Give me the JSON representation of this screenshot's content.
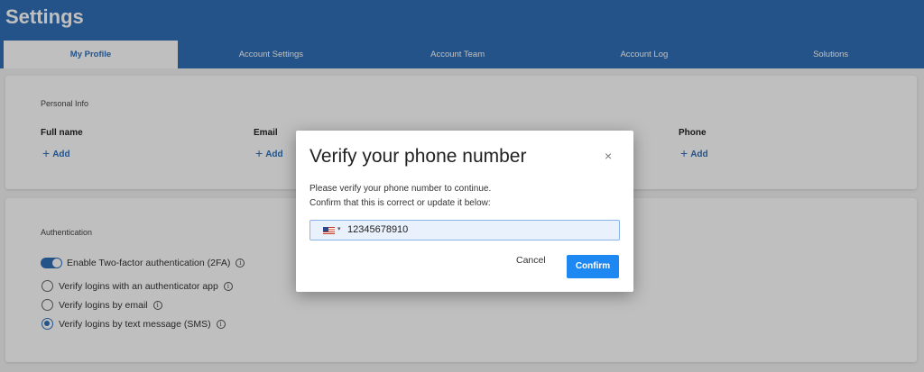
{
  "header": {
    "title": "Settings",
    "tabs": [
      {
        "label": "My Profile"
      },
      {
        "label": "Account Settings"
      },
      {
        "label": "Account Team"
      },
      {
        "label": "Account Log"
      },
      {
        "label": "Solutions"
      }
    ]
  },
  "personal_info": {
    "section_title": "Personal Info",
    "fields": [
      {
        "label": "Full name",
        "action": "Add"
      },
      {
        "label": "Email",
        "action": "Add"
      },
      {
        "label": "Phone",
        "action": "Add"
      }
    ]
  },
  "authentication": {
    "section_title": "Authentication",
    "toggle_label": "Enable Two-factor authentication (2FA)",
    "toggle_on": true,
    "options": [
      {
        "label": "Verify logins with an authenticator app",
        "checked": false
      },
      {
        "label": "Verify logins by email",
        "checked": false
      },
      {
        "label": "Verify logins by text message (SMS)",
        "checked": true
      }
    ],
    "info_glyph": "i"
  },
  "modal": {
    "title": "Verify your phone number",
    "close_glyph": "×",
    "message_line1": "Please verify your phone number to continue.",
    "message_line2": "Confirm that this is correct or update it below:",
    "country_flag_icon": "us-flag-icon",
    "caret_glyph": "▾",
    "phone_value": "12345678910",
    "cancel_label": "Cancel",
    "confirm_label": "Confirm"
  },
  "colors": {
    "brand": "#2f6fb7",
    "confirm_button": "#1d88f2"
  }
}
